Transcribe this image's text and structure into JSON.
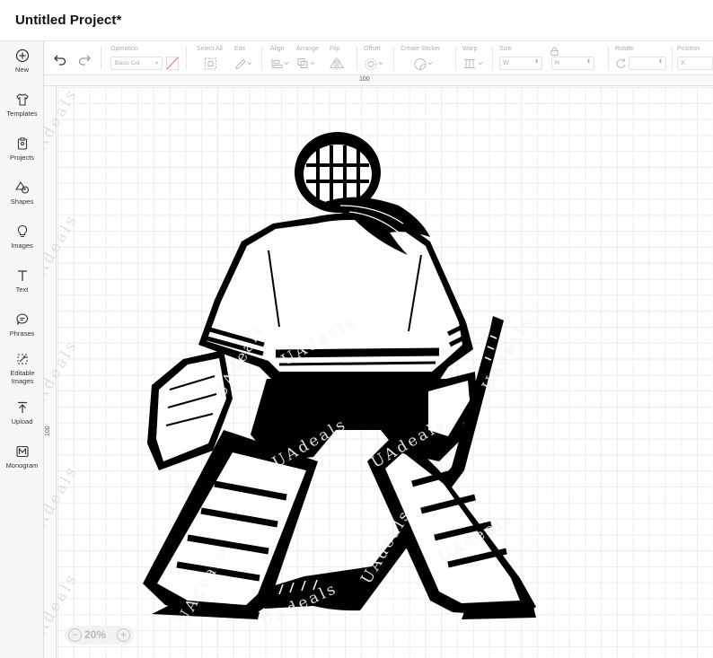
{
  "window": {
    "title": "Untitled Project*"
  },
  "sidebar": {
    "items": [
      {
        "label": "New",
        "icon": "plus-circle-icon"
      },
      {
        "label": "Templates",
        "icon": "shirt-icon"
      },
      {
        "label": "Projects",
        "icon": "clipboard-icon"
      },
      {
        "label": "Shapes",
        "icon": "shapes-icon"
      },
      {
        "label": "Images",
        "icon": "lightbulb-icon"
      },
      {
        "label": "Text",
        "icon": "text-icon"
      },
      {
        "label": "Phrases",
        "icon": "speech-bubble-icon"
      },
      {
        "label": "Editable Images",
        "icon": "editable-image-icon"
      },
      {
        "label": "Upload",
        "icon": "upload-icon"
      },
      {
        "label": "Monogram",
        "icon": "monogram-icon"
      }
    ]
  },
  "toolbar": {
    "undo_icon": "undo-icon",
    "redo_icon": "redo-icon",
    "operation_label": "Operation",
    "operation_value": "Basic Cut",
    "select_all_label": "Select All",
    "edit_label": "Edit",
    "align_label": "Align",
    "arrange_label": "Arrange",
    "flip_label": "Flip",
    "offset_label": "Offset",
    "create_sticker_label": "Create Sticker",
    "warp_label": "Warp",
    "size_label": "Size",
    "size_w": "W",
    "size_h": "H",
    "rotate_label": "Rotate",
    "position_label": "Position",
    "position_x": "X"
  },
  "canvas": {
    "ruler_top_mark": "100",
    "ruler_left_mark": "100",
    "zoom_value": "20%",
    "watermark": "UAdeals"
  },
  "colors": {
    "ink": "#000000",
    "grid_line": "#ececec",
    "sidebar_bg": "#f7f7f7"
  }
}
